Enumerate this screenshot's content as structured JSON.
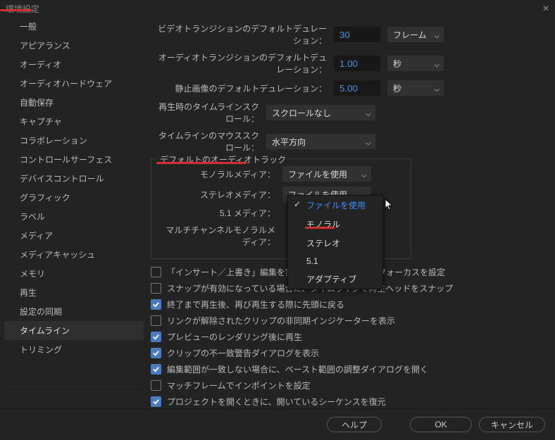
{
  "window": {
    "title": "環境設定"
  },
  "sidebar": {
    "items": [
      "一般",
      "アピアランス",
      "オーディオ",
      "オーディオハードウェア",
      "自動保存",
      "キャプチャ",
      "コラボレーション",
      "コントロールサーフェス",
      "デバイスコントロール",
      "グラフィック",
      "ラベル",
      "メディア",
      "メディアキャッシュ",
      "メモリ",
      "再生",
      "設定の同期",
      "タイムライン",
      "トリミング"
    ],
    "active": 16
  },
  "fields": {
    "videoTransition": {
      "label": "ビデオトランジションのデフォルトデュレーション：",
      "value": "30",
      "unit": "フレーム"
    },
    "audioTransition": {
      "label": "オーディオトランジションのデフォルトデュレーション：",
      "value": "1.00",
      "unit": "秒"
    },
    "stillImage": {
      "label": "静止画像のデフォルトデュレーション：",
      "value": "5.00",
      "unit": "秒"
    },
    "timelineScroll": {
      "label": "再生時のタイムラインスクロール：",
      "value": "スクロールなし"
    },
    "mouseScroll": {
      "label": "タイムラインのマウススクロール：",
      "value": "水平方向"
    }
  },
  "audioGroup": {
    "title": "デフォルトのオーディオトラック",
    "rows": {
      "mono": {
        "label": "モノラルメディア：",
        "value": "ファイルを使用"
      },
      "stereo": {
        "label": "ステレオメディア：",
        "value": "ファイルを使用"
      },
      "fiveOne": {
        "label": "5.1 メディア：",
        "value": ""
      },
      "multi": {
        "label": "マルチチャンネルモノラルメディア：",
        "value": ""
      }
    },
    "dropdownOptions": [
      "ファイルを使用",
      "モノラル",
      "ステレオ",
      "5.1",
      "アダプティブ"
    ]
  },
  "checks": [
    {
      "checked": false,
      "label": "「インサート／上書き」編集を実行後、タイムラインにフォーカスを設定"
    },
    {
      "checked": false,
      "label": "スナップが有効になっている場合に、タイムラインで再生ヘッドをスナップ"
    },
    {
      "checked": true,
      "label": "終了まで再生後、再び再生する際に先頭に戻る"
    },
    {
      "checked": false,
      "label": "リンクが解除されたクリップの非同期インジケーターを表示"
    },
    {
      "checked": true,
      "label": "プレビューのレンダリング後に再生"
    },
    {
      "checked": true,
      "label": "クリップの不一致警告ダイアログを表示"
    },
    {
      "checked": true,
      "label": "編集範囲が一致しない場合に、ペースト範囲の調整ダイアログを開く"
    },
    {
      "checked": false,
      "label": "マッチフレームでインポイントを設定"
    },
    {
      "checked": true,
      "label": "プロジェクトを開くときに、開いているシーケンスを復元"
    }
  ],
  "footer": {
    "help": "ヘルプ",
    "ok": "OK",
    "cancel": "キャンセル"
  }
}
